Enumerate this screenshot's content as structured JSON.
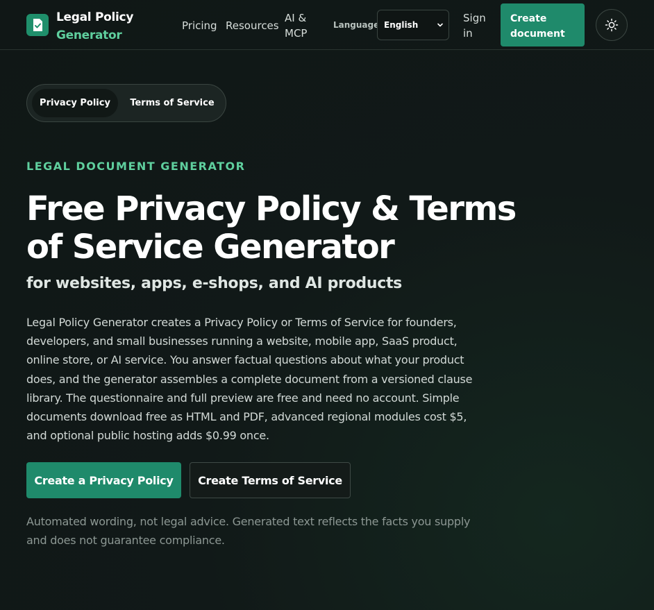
{
  "header": {
    "brand": {
      "line1": "Legal Policy",
      "line2": "Generator",
      "icon": "document-check-icon"
    },
    "nav": [
      {
        "label": "Pricing"
      },
      {
        "label": "Resources"
      },
      {
        "label": "AI & MCP"
      }
    ],
    "language": {
      "label": "Language",
      "selected": "English"
    },
    "sign_in": "Sign in",
    "create_document": "Create document",
    "theme_icon": "sun-icon"
  },
  "tabs": [
    {
      "label": "Privacy Policy",
      "active": true
    },
    {
      "label": "Terms of Service",
      "active": false
    }
  ],
  "hero": {
    "eyebrow": "LEGAL DOCUMENT GENERATOR",
    "title": "Free Privacy Policy & Terms of Service Generator",
    "subtitle": "for websites, apps, e-shops, and AI products",
    "description": "Legal Policy Generator creates a Privacy Policy or Terms of Service for founders, developers, and small businesses running a website, mobile app, SaaS product, online store, or AI service. You answer factual questions about what your product does, and the generator assembles a complete document from a versioned clause library. The questionnaire and full preview are free and need no account. Simple documents download free as HTML and PDF, advanced regional modules cost $5, and optional public hosting adds $0.99 once.",
    "primary_cta": "Create a Privacy Policy",
    "secondary_cta": "Create Terms of Service",
    "disclaimer": "Automated wording, not legal advice. Generated text reflects the facts you supply and does not guarantee compliance."
  },
  "colors": {
    "accent": "#1f8a6b",
    "accent_text": "#5fcf9e",
    "background": "#111918"
  }
}
